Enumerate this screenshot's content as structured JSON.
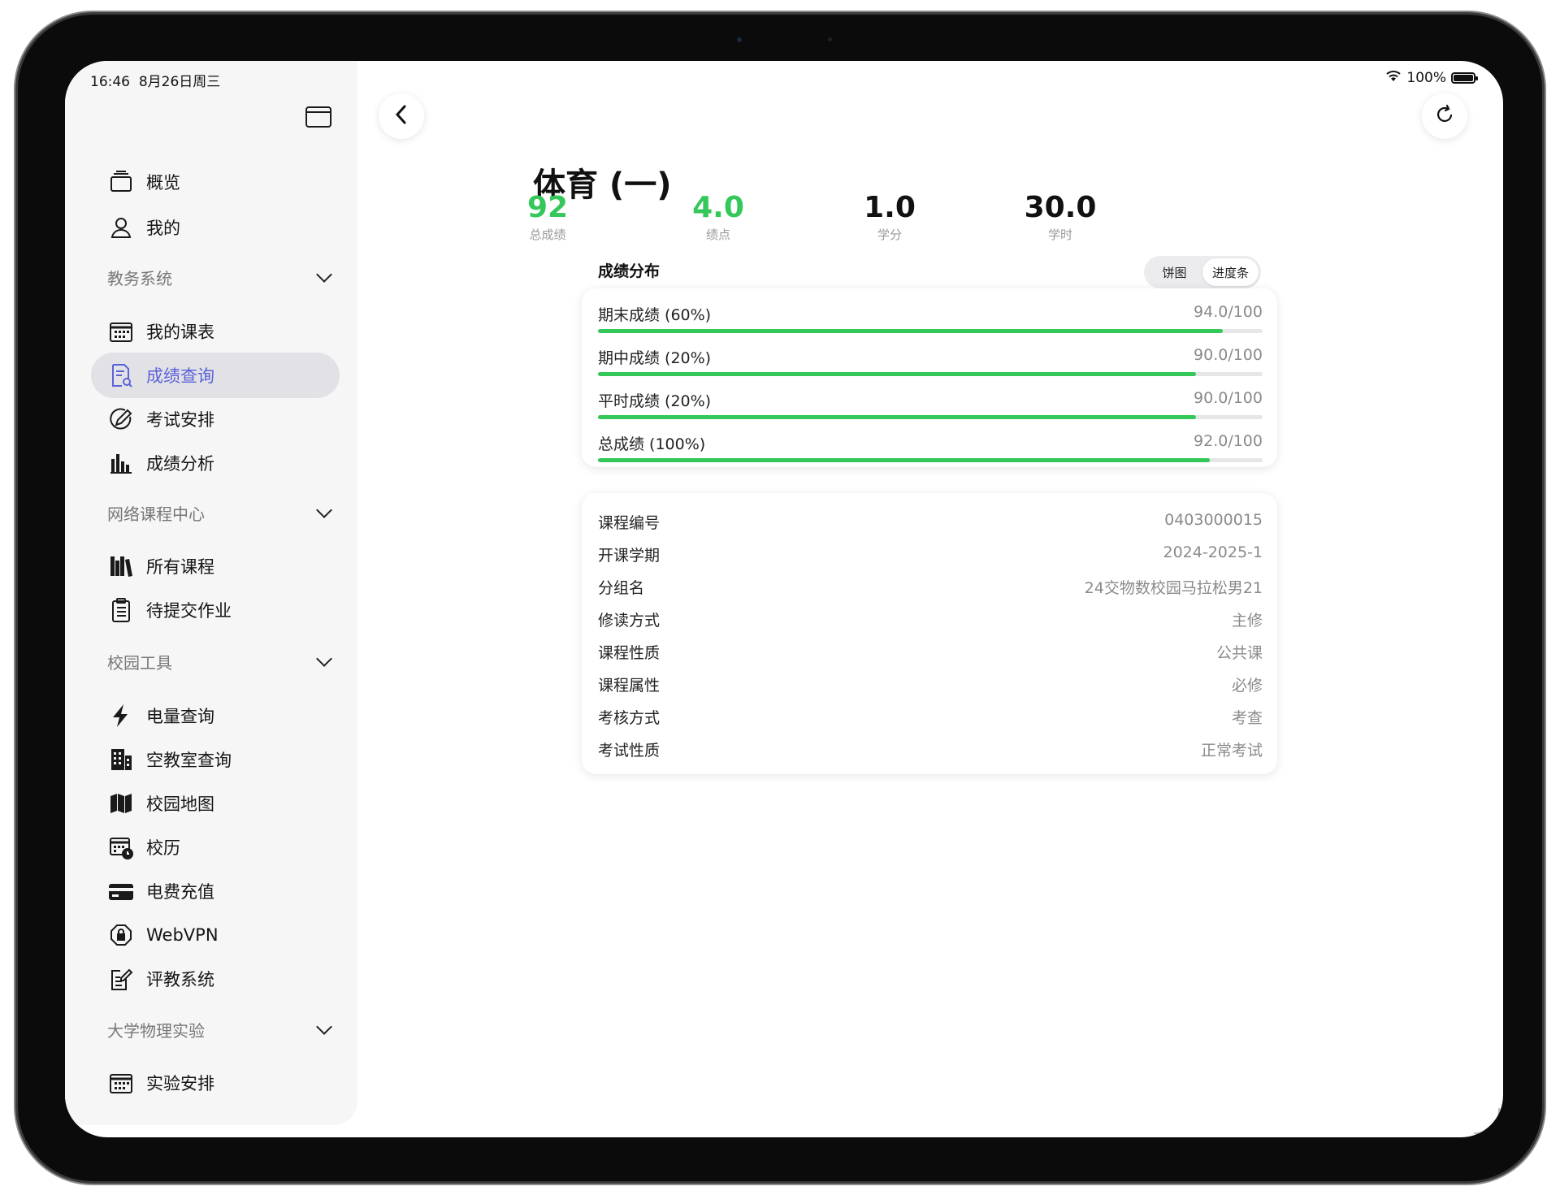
{
  "status_bar": {
    "time": "16:46",
    "date": "8月26日周三",
    "battery": "100%",
    "battery_level": 1.0
  },
  "sidebar": {
    "top_items": [
      {
        "label": "概览",
        "icon": "overview-icon"
      },
      {
        "label": "我的",
        "icon": "person-icon"
      }
    ],
    "sections": [
      {
        "label": "教务系统",
        "items": [
          {
            "label": "我的课表",
            "icon": "calendar-grid-icon"
          },
          {
            "label": "成绩查询",
            "icon": "document-search-icon",
            "active": true
          },
          {
            "label": "考试安排",
            "icon": "pen-circle-icon"
          },
          {
            "label": "成绩分析",
            "icon": "bar-chart-icon"
          }
        ]
      },
      {
        "label": "网络课程中心",
        "items": [
          {
            "label": "所有课程",
            "icon": "books-icon"
          },
          {
            "label": "待提交作业",
            "icon": "clipboard-icon"
          }
        ]
      },
      {
        "label": "校园工具",
        "items": [
          {
            "label": "电量查询",
            "icon": "bolt-icon"
          },
          {
            "label": "空教室查询",
            "icon": "building-icon"
          },
          {
            "label": "校园地图",
            "icon": "map-icon"
          },
          {
            "label": "校历",
            "icon": "calendar-clock-icon"
          },
          {
            "label": "电费充值",
            "icon": "credit-card-icon"
          },
          {
            "label": "WebVPN",
            "icon": "shield-lock-icon"
          },
          {
            "label": "评教系统",
            "icon": "edit-note-icon"
          }
        ]
      },
      {
        "label": "大学物理实验",
        "items": [
          {
            "label": "实验安排",
            "icon": "calendar-grid-icon"
          }
        ]
      }
    ]
  },
  "course": {
    "title": "体育 (一)",
    "stats": [
      {
        "value": "92",
        "label": "总成绩",
        "color": "#34c759"
      },
      {
        "value": "4.0",
        "label": "绩点",
        "color": "#34c759"
      },
      {
        "value": "1.0",
        "label": "学分",
        "color": "#111111"
      },
      {
        "value": "30.0",
        "label": "学时",
        "color": "#111111"
      }
    ]
  },
  "distribution": {
    "title": "成绩分布",
    "view_options": [
      "饼图",
      "进度条"
    ],
    "selected_view": "进度条",
    "rows": [
      {
        "label": "期末成绩 (60%)",
        "value": "94.0/100",
        "percent": 94
      },
      {
        "label": "期中成绩 (20%)",
        "value": "90.0/100",
        "percent": 90
      },
      {
        "label": "平时成绩 (20%)",
        "value": "90.0/100",
        "percent": 90
      },
      {
        "label": "总成绩 (100%)",
        "value": "92.0/100",
        "percent": 92
      }
    ],
    "bar_color": "#34c759"
  },
  "info": [
    {
      "label": "课程编号",
      "value": "0403000015"
    },
    {
      "label": "开课学期",
      "value": "2024-2025-1"
    },
    {
      "label": "分组名",
      "value": "24交物数校园马拉松男21"
    },
    {
      "label": "修读方式",
      "value": "主修"
    },
    {
      "label": "课程性质",
      "value": "公共课"
    },
    {
      "label": "课程属性",
      "value": "必修"
    },
    {
      "label": "考核方式",
      "value": "考查"
    },
    {
      "label": "考试性质",
      "value": "正常考试"
    }
  ],
  "accent_color": "#5b62d8"
}
